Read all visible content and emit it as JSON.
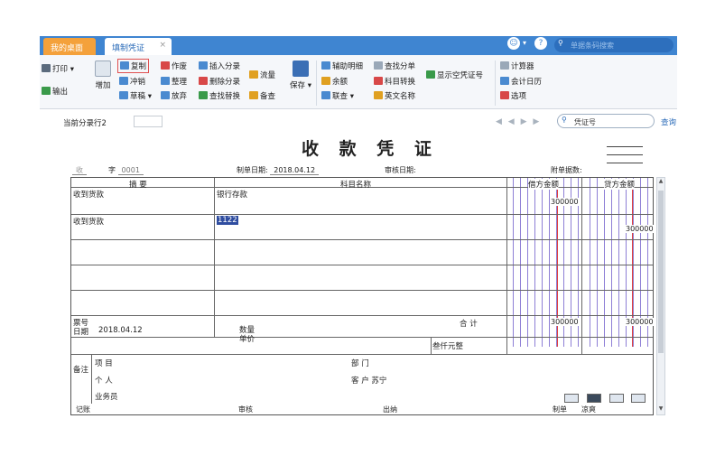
{
  "tabs": {
    "home": "我的桌面",
    "voucher": "填制凭证",
    "close": "×"
  },
  "search_top": {
    "placeholder": "单据条码搜索"
  },
  "toolbar": {
    "print": "打印",
    "export": "输出",
    "add": "增加",
    "copy": "复制",
    "reverse": "冲销",
    "draft": "草稿",
    "void": "作废",
    "tidy": "整理",
    "discard": "放弃",
    "insert_entry": "插入分录",
    "delete_entry": "删除分录",
    "find_replace": "查找替换",
    "flow": "流量",
    "memo": "备查",
    "save": "保存",
    "aux_detail": "辅助明细",
    "balance": "余额",
    "link": "联查",
    "find_entry": "查找分单",
    "subject_convert": "科目转换",
    "english_name": "英文名称",
    "show_empty_no": "显示空凭证号",
    "calculator": "计算器",
    "calendar": "会计日历",
    "options": "选项"
  },
  "content": {
    "current_row_label": "当前分录行2",
    "nav_buttons": "◀ ◀ ▶ ▶",
    "voucher_search": "凭证号",
    "query": "查询",
    "title": "收 款 凭 证",
    "header": {
      "type_label": "收",
      "num_label": "字",
      "number": "0001",
      "date_label": "制单日期:",
      "date": "2018.04.12",
      "audit_label": "审核日期:",
      "attach_label": "附单据数:"
    },
    "columns": {
      "summary": "摘 要",
      "subject": "科目名称",
      "debit": "借方金额",
      "credit": "贷方金额"
    },
    "rows": [
      {
        "summary": "收到货款",
        "subject": "银行存款",
        "debit": "300000",
        "credit": ""
      },
      {
        "summary": "收到货款",
        "subject": "1122",
        "debit": "",
        "credit": "300000"
      }
    ],
    "footer": {
      "ticket_no": "票号",
      "date_label": "日期",
      "date": "2018.04.12",
      "qty": "数量",
      "price": "单价",
      "total_label": "合 计",
      "total_debit": "300000",
      "total_credit": "300000",
      "total_words": "叁仟元整",
      "note": "备注",
      "project": "项 目",
      "dept": "部 门",
      "person": "个 人",
      "customer": "客 户 苏宁",
      "salesman": "业务员"
    },
    "sign": {
      "bookkeep": "记账",
      "audit": "审核",
      "cashier": "出纳",
      "maker_label": "制单",
      "maker": "凉爽"
    }
  },
  "colors": {
    "tabbar": "#3f85d1",
    "home_tab": "#f4a13b",
    "grid_line": "#8e7fd6",
    "red_line": "#e04040",
    "selection": "#2f4da0"
  }
}
